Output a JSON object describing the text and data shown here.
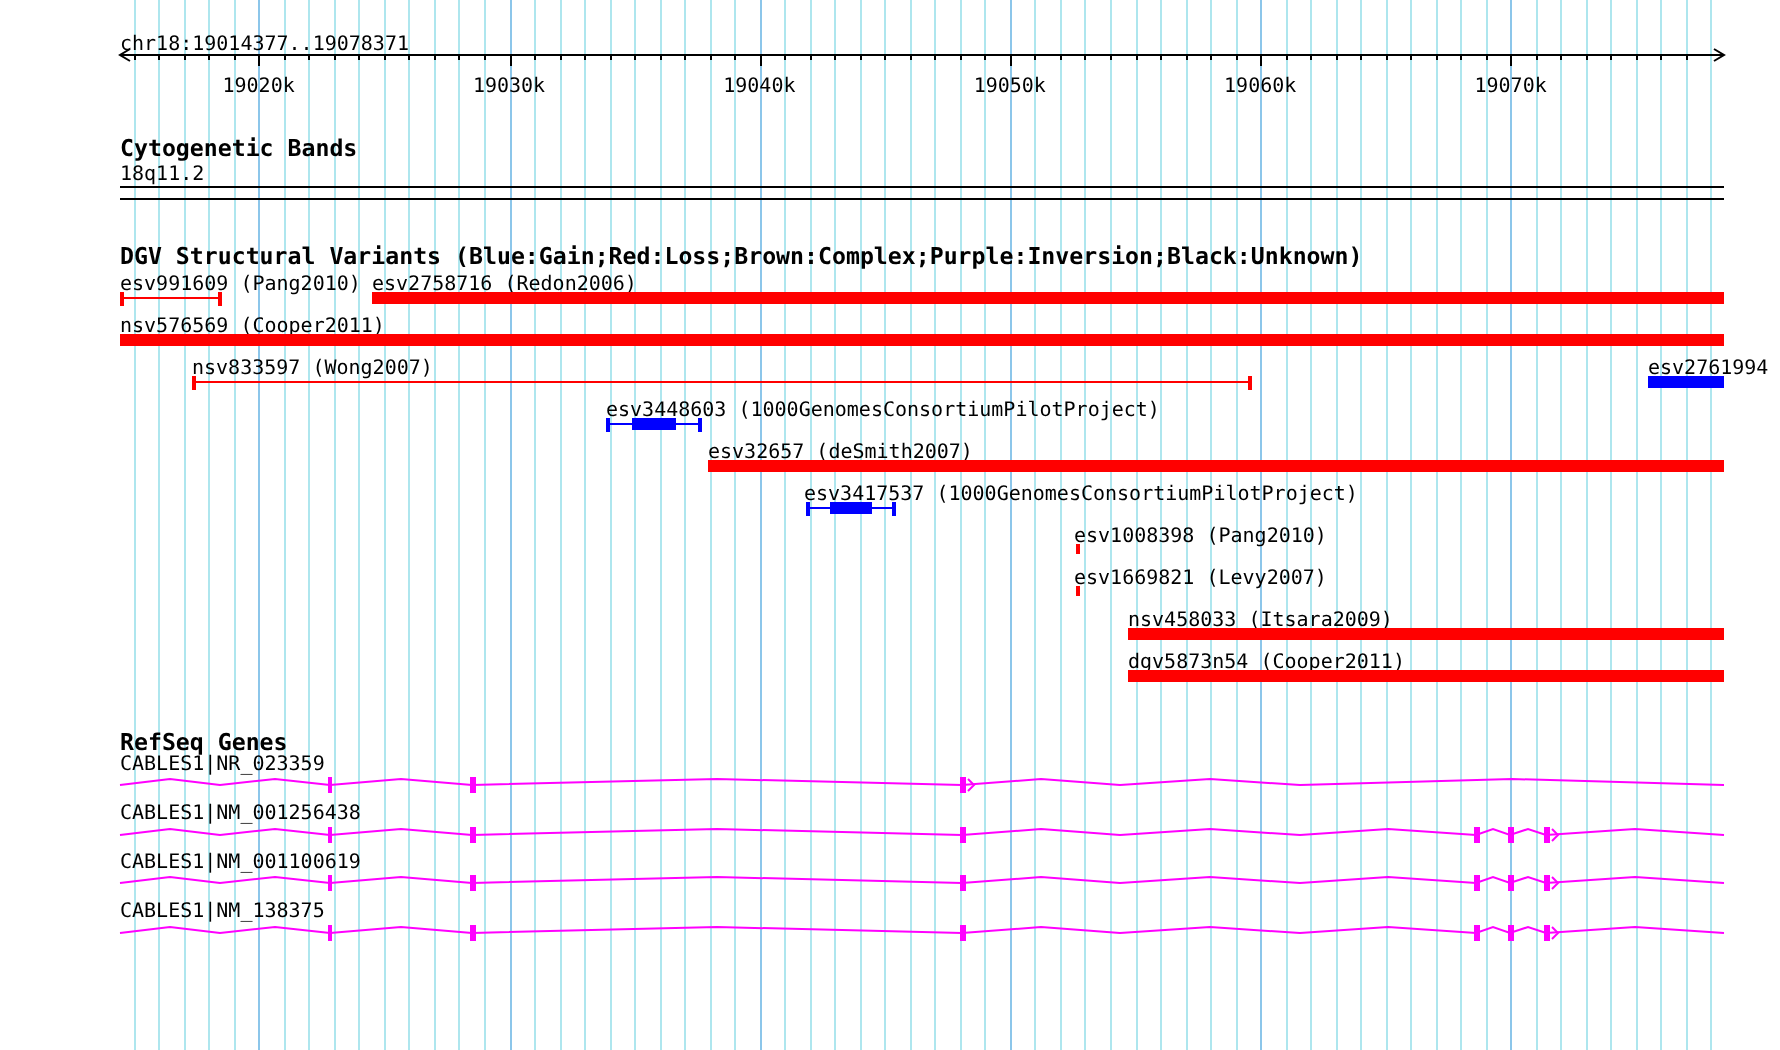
{
  "ruler": {
    "title": "chr18:19014377..19078371",
    "ticks": [
      "19020k",
      "19030k",
      "19040k",
      "19050k",
      "19060k",
      "19070k"
    ]
  },
  "cytogenetic_bands": {
    "title": "Cytogenetic Bands",
    "band": "18q11.2"
  },
  "structural_variants": {
    "title": "DGV Structural Variants (Blue:Gain;Red:Loss;Brown:Complex;Purple:Inversion;Black:Unknown)",
    "rows": [
      {
        "features": [
          {
            "label": "esv991609 (Pang2010)",
            "kind": "span",
            "color": "#ff0000"
          },
          {
            "label": "esv2758716 (Redon2006)",
            "kind": "bar",
            "color": "#ff0000"
          }
        ]
      },
      {
        "features": [
          {
            "label": "nsv576569 (Cooper2011)",
            "kind": "bar",
            "color": "#ff0000"
          }
        ]
      },
      {
        "features": [
          {
            "label": "nsv833597 (Wong2007)",
            "kind": "span",
            "color": "#ff0000"
          },
          {
            "label": "esv2761994",
            "kind": "bar",
            "color": "#0000ff"
          }
        ]
      },
      {
        "features": [
          {
            "label": "esv3448603 (1000GenomesConsortiumPilotProject)",
            "kind": "cored",
            "color": "#0000ff"
          }
        ]
      },
      {
        "features": [
          {
            "label": "esv32657 (deSmith2007)",
            "kind": "bar",
            "color": "#ff0000"
          }
        ]
      },
      {
        "features": [
          {
            "label": "esv3417537 (1000GenomesConsortiumPilotProject)",
            "kind": "cored",
            "color": "#0000ff"
          }
        ]
      },
      {
        "features": [
          {
            "label": "esv1008398 (Pang2010)",
            "kind": "tick",
            "color": "#ff0000"
          }
        ]
      },
      {
        "features": [
          {
            "label": "esv1669821 (Levy2007)",
            "kind": "tick",
            "color": "#ff0000"
          }
        ]
      },
      {
        "features": [
          {
            "label": "nsv458033 (Itsara2009)",
            "kind": "bar",
            "color": "#ff0000"
          }
        ]
      },
      {
        "features": [
          {
            "label": "dgv5873n54 (Cooper2011)",
            "kind": "bar",
            "color": "#ff0000"
          }
        ]
      }
    ]
  },
  "refseq_genes": {
    "title": "RefSeq Genes",
    "genes": [
      {
        "label": "CABLES1|NR_023359",
        "kind": "noncoding"
      },
      {
        "label": "CABLES1|NM_001256438",
        "kind": "coding"
      },
      {
        "label": "CABLES1|NM_001100619",
        "kind": "coding"
      },
      {
        "label": "CABLES1|NM_138375",
        "kind": "coding"
      }
    ]
  }
}
